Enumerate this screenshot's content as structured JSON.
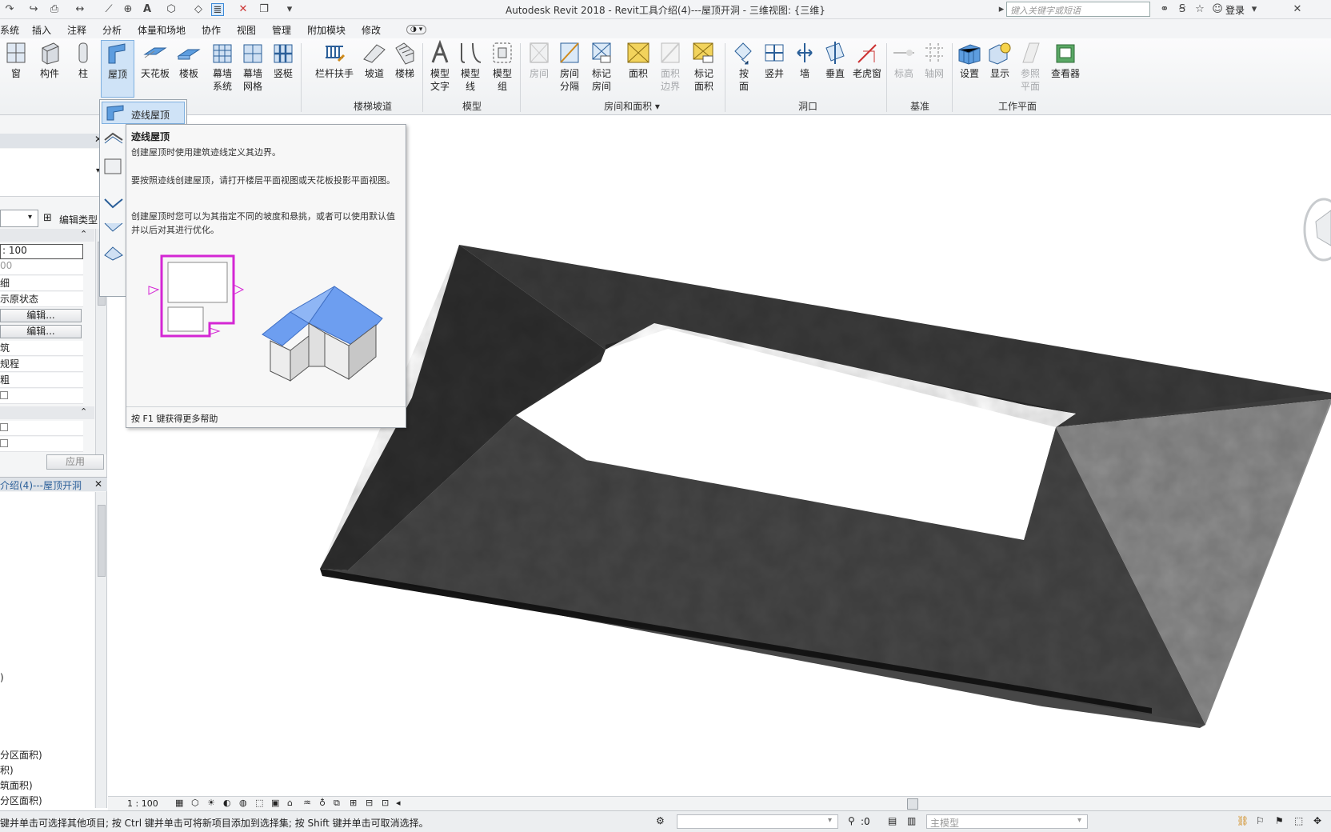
{
  "titlebar": {
    "title": "Autodesk Revit 2018 -      Revit工具介绍(4)---屋顶开洞 - 三维视图: {三维}",
    "search_placeholder": "键入关键字或短语",
    "login_label": "登录"
  },
  "tabs": [
    "系统",
    "插入",
    "注释",
    "分析",
    "体量和场地",
    "协作",
    "视图",
    "管理",
    "附加模块",
    "修改"
  ],
  "ribbon": {
    "build": {
      "window": "窗",
      "component": "构件",
      "column": "柱",
      "roof": "屋顶",
      "ceiling": "天花板",
      "floor": "楼板",
      "curtain_system": "幕墙\n系统",
      "curtain_grid": "幕墙\n网格",
      "mullion": "竖梃"
    },
    "circulation": {
      "railing": "栏杆扶手",
      "ramp": "坡道",
      "stair": "楼梯",
      "panel_label": "楼梯坡道"
    },
    "model": {
      "model_text": "模型\n文字",
      "model_line": "模型\n线",
      "model_group": "模型\n组",
      "panel_label": "模型"
    },
    "room_area": {
      "room": "房间",
      "room_separator": "房间\n分隔",
      "tag_room": "标记\n房间",
      "area": "面积",
      "area_boundary": "面积\n边界",
      "tag_area": "标记\n面积",
      "panel_label": "房间和面积"
    },
    "opening": {
      "by_face": "按\n面",
      "shaft": "竖井",
      "wall": "墙",
      "vertical": "垂直",
      "dormer": "老虎窗",
      "panel_label": "洞口"
    },
    "datum": {
      "level": "标高",
      "grid": "轴网",
      "panel_label": "基准"
    },
    "work_plane": {
      "set": "设置",
      "show": "显示",
      "ref_plane": "参照\n平面",
      "viewer": "查看器",
      "panel_label": "工作平面"
    }
  },
  "roof_dropdown": {
    "footprint_label": "迹线屋顶"
  },
  "tooltip": {
    "title": "迹线屋顶",
    "p1": "创建屋顶时使用建筑迹线定义其边界。",
    "p2": "要按照迹线创建屋顶，请打开楼层平面视图或天花板投影平面视图。",
    "p3": "创建屋顶时您可以为其指定不同的坡度和悬挑，或者可以使用默认值并以后对其进行优化。",
    "footer": "按 F1 键获得更多帮助"
  },
  "properties": {
    "edit_type": "编辑类型",
    "rows": [
      ": 100",
      "00",
      "细",
      "示原状态"
    ],
    "edit_btn": "编辑...",
    "rows2": [
      "筑",
      "规程",
      "粗"
    ],
    "apply": "应用"
  },
  "project_browser": {
    "title": "介绍(4)---屋顶开洞",
    "items": [
      ")",
      "分区面积)",
      "积)",
      "筑面积)",
      "分区面积)"
    ]
  },
  "viewbar": {
    "scale": "1 : 100"
  },
  "statusbar": {
    "hint": "键并单击可选择其他项目; 按 Ctrl 键并单击可将新项目添加到选择集; 按 Shift 键并单击可取消选择。",
    "coord": ":0",
    "model": "主模型"
  },
  "colors": {
    "accent": "#3d8ad8",
    "roof_dark": "#3a3a3a",
    "roof_light": "#8c8c8c",
    "highlight": "#cfe3f7"
  }
}
